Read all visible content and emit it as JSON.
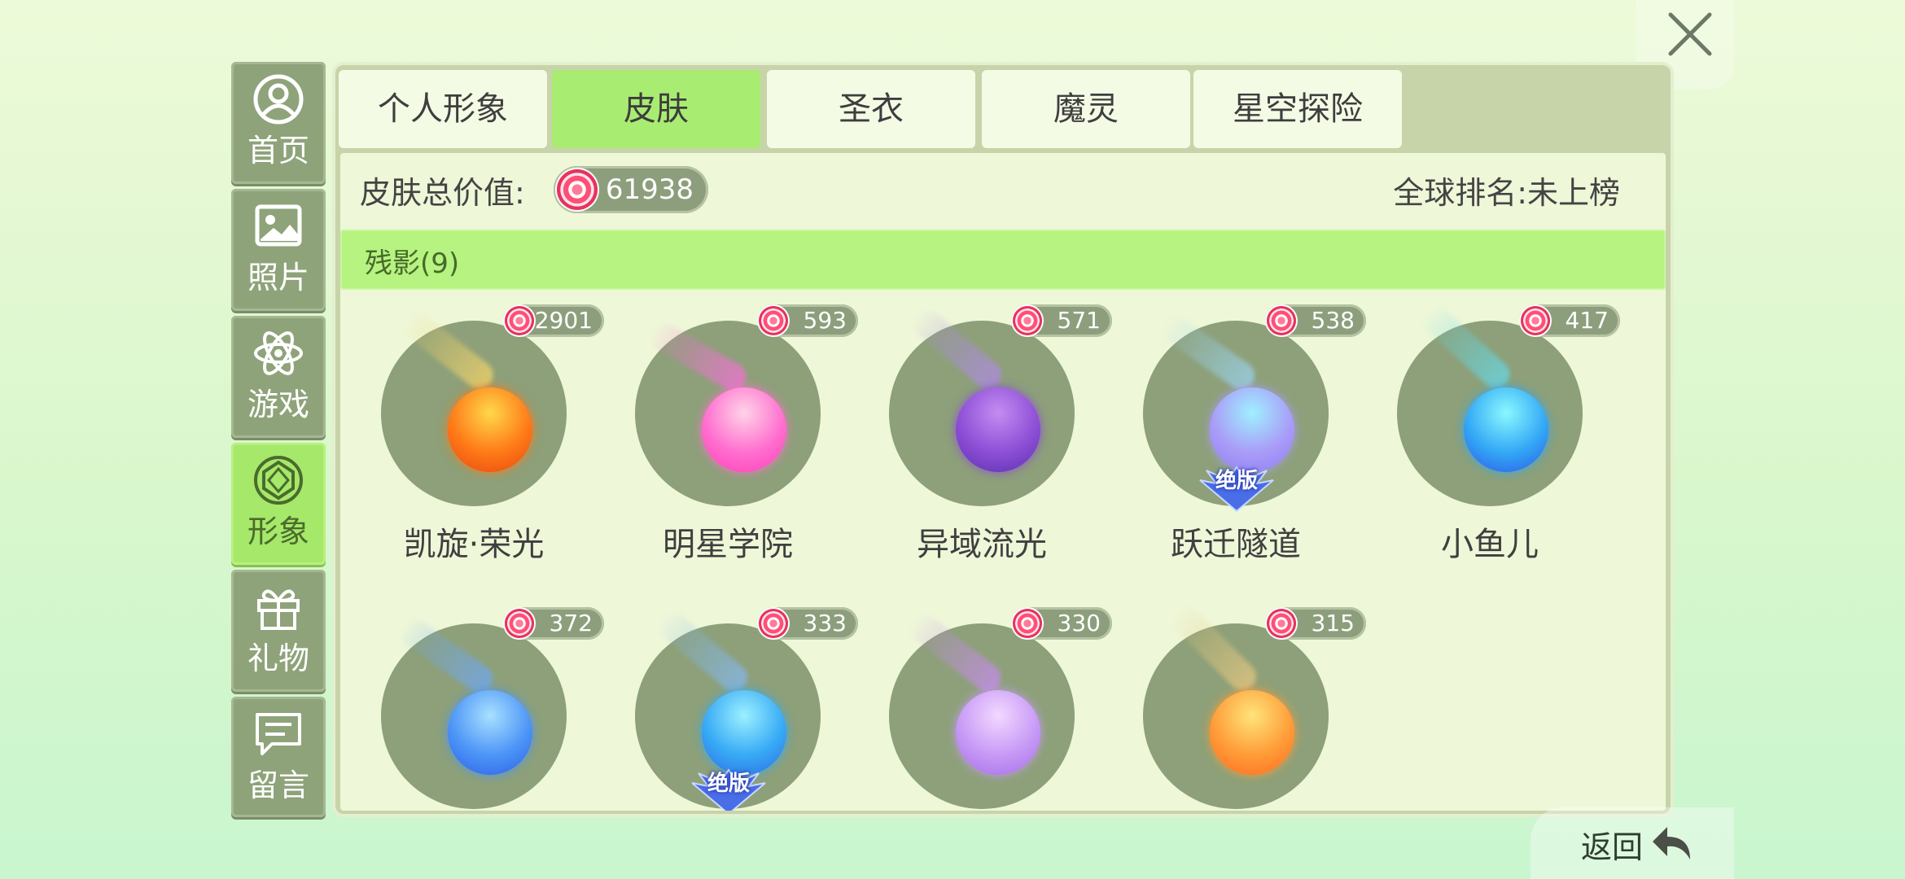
{
  "sidebar": {
    "items": [
      {
        "label": "首页",
        "icon": "home-profile-icon"
      },
      {
        "label": "照片",
        "icon": "photo-icon"
      },
      {
        "label": "游戏",
        "icon": "atom-game-icon"
      },
      {
        "label": "形象",
        "icon": "gem-image-icon",
        "active": true
      },
      {
        "label": "礼物",
        "icon": "gift-icon"
      },
      {
        "label": "留言",
        "icon": "message-icon"
      }
    ]
  },
  "tabs": [
    {
      "label": "个人形象"
    },
    {
      "label": "皮肤",
      "active": true
    },
    {
      "label": "圣衣"
    },
    {
      "label": "魔灵"
    },
    {
      "label": "星空探险"
    }
  ],
  "summary": {
    "value_label": "皮肤总价值:",
    "total_value": "61938",
    "rank_text": "全球排名:未上榜"
  },
  "category": {
    "label": "残影(9)"
  },
  "skins": [
    {
      "name": "凯旋·荣光",
      "price": "2901",
      "colors": [
        "#ffd84a",
        "#ff7a18",
        "#e8470f"
      ],
      "trail": "#f6d66a"
    },
    {
      "name": "明星学院",
      "price": "593",
      "colors": [
        "#ffd3e8",
        "#ff6fcf",
        "#ff3fb8"
      ],
      "trail": "#f86fd9"
    },
    {
      "name": "异域流光",
      "price": "571",
      "colors": [
        "#c48cf2",
        "#8d4fd6",
        "#5b2fb0"
      ],
      "trail": "#b08ae8"
    },
    {
      "name": "跃迁隧道",
      "price": "538",
      "colors": [
        "#9ff0ff",
        "#a99cf8",
        "#8d7ef0"
      ],
      "trail": "#9ad4f0",
      "badge": "绝版"
    },
    {
      "name": "小鱼儿",
      "price": "417",
      "colors": [
        "#8af8ff",
        "#33a8f5",
        "#2c58e8"
      ],
      "trail": "#66d9e8"
    },
    {
      "name": "",
      "price": "372",
      "colors": [
        "#a8e0ff",
        "#4d95f7",
        "#2b5fe6"
      ],
      "trail": "#6fa8f5"
    },
    {
      "name": "",
      "price": "333",
      "colors": [
        "#9cf0ff",
        "#37aaf5",
        "#2d6ae6"
      ],
      "trail": "#84b8f0",
      "badge": "绝版"
    },
    {
      "name": "",
      "price": "330",
      "colors": [
        "#f3d8ff",
        "#c79af6",
        "#a66de8"
      ],
      "trail": "#c98af0"
    },
    {
      "name": "",
      "price": "315",
      "colors": [
        "#ffe47a",
        "#ff9c38",
        "#ff6a20"
      ],
      "trail": "#e8c880"
    }
  ],
  "back": {
    "label": "返回"
  }
}
